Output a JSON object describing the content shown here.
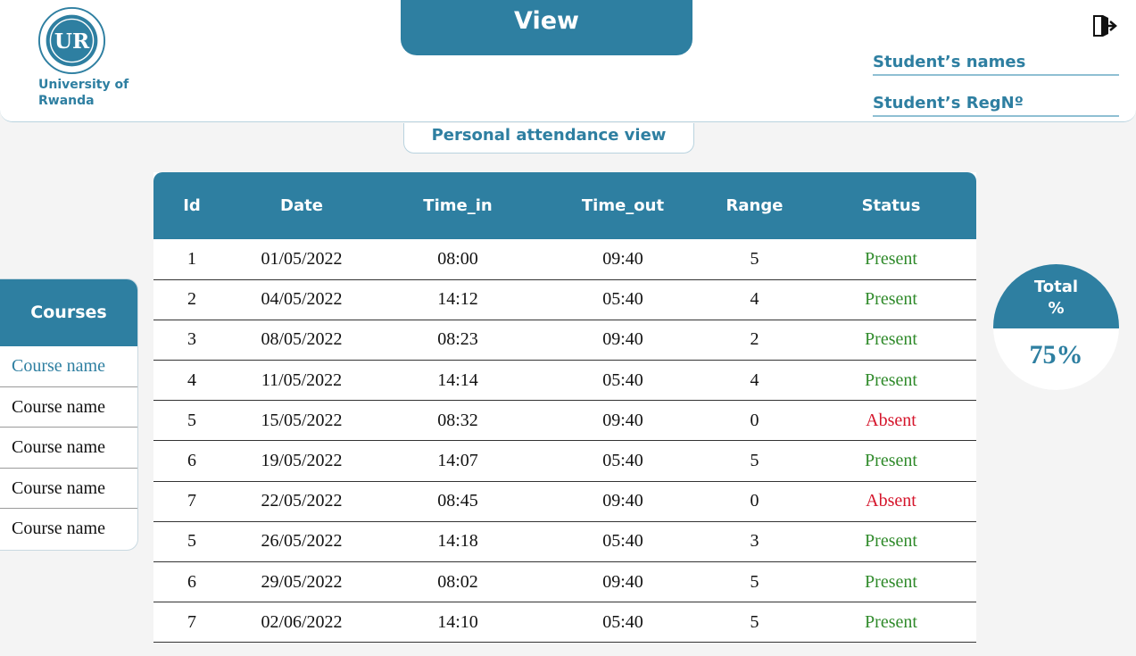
{
  "header": {
    "university": "University of Rwanda",
    "logo_text": "UR",
    "view_title": "View",
    "student_names_label": "Student’s names",
    "student_reg_label": "Student’s RegNº",
    "logout_icon": "logout-icon",
    "accent_color": "#2e7fa1"
  },
  "subtitle": "Personal attendance view",
  "courses": {
    "title": "Courses",
    "items": [
      "Course name",
      "Course name",
      "Course name",
      "Course name",
      "Course name"
    ]
  },
  "table": {
    "columns": [
      "Id",
      "Date",
      "Time_in",
      "Time_out",
      "Range",
      "Status"
    ],
    "rows": [
      [
        "1",
        "01/05/2022",
        "08:00",
        "09:40",
        "5",
        "Present"
      ],
      [
        "2",
        "04/05/2022",
        "14:12",
        "05:40",
        "4",
        "Present"
      ],
      [
        "3",
        "08/05/2022",
        "08:23",
        "09:40",
        "2",
        "Present"
      ],
      [
        "4",
        "11/05/2022",
        "14:14",
        "05:40",
        "4",
        "Present"
      ],
      [
        "5",
        "15/05/2022",
        "08:32",
        "09:40",
        "0",
        "Absent"
      ],
      [
        "6",
        "19/05/2022",
        "14:07",
        "05:40",
        "5",
        "Present"
      ],
      [
        "7",
        "22/05/2022",
        "08:45",
        "09:40",
        "0",
        "Absent"
      ],
      [
        "5",
        "26/05/2022",
        "14:18",
        "05:40",
        "3",
        "Present"
      ],
      [
        "6",
        "29/05/2022",
        "08:02",
        "09:40",
        "5",
        "Present"
      ],
      [
        "7",
        "02/06/2022",
        "14:10",
        "05:40",
        "5",
        "Present"
      ]
    ],
    "status_colors": {
      "Present": "#2f8a2a",
      "Absent": "#d5152b"
    }
  },
  "total": {
    "label_line1": "Total",
    "label_line2": "%",
    "value": "75%"
  }
}
